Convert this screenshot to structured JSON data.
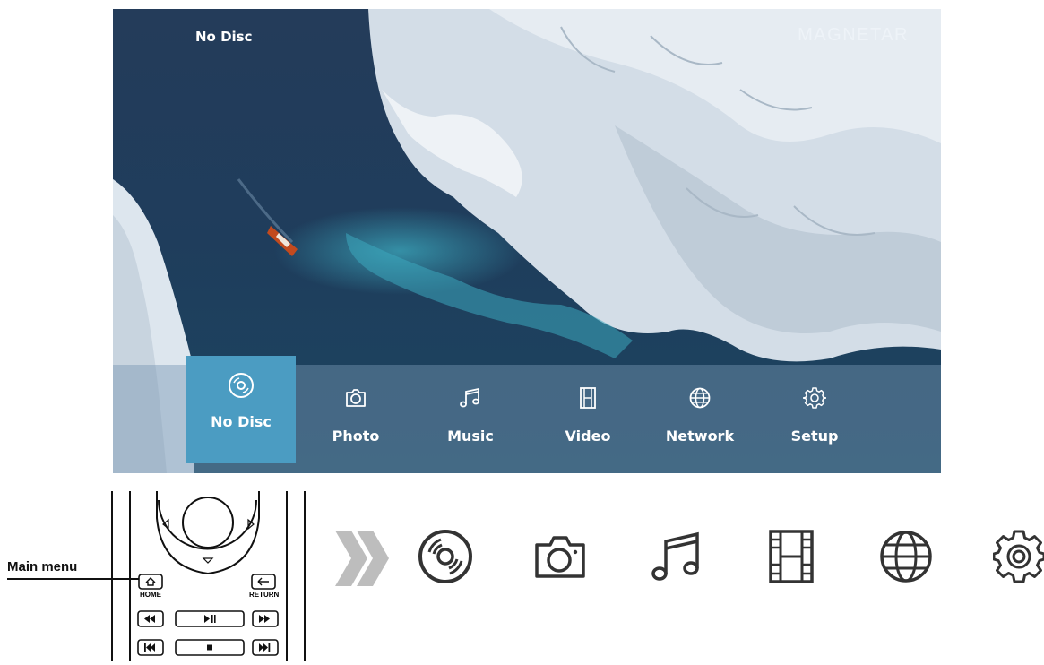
{
  "screen": {
    "title": "No Disc",
    "brand": "MAGNETAR"
  },
  "menu": {
    "items": [
      {
        "label": "No Disc",
        "icon": "disc-icon",
        "selected": true
      },
      {
        "label": "Photo",
        "icon": "camera-icon"
      },
      {
        "label": "Music",
        "icon": "music-note-icon"
      },
      {
        "label": "Video",
        "icon": "film-icon"
      },
      {
        "label": "Network",
        "icon": "globe-icon"
      },
      {
        "label": "Setup",
        "icon": "gear-icon"
      }
    ]
  },
  "remote": {
    "callout": "Main menu",
    "home_label": "HOME",
    "return_label": "RETURN"
  },
  "icon_strip": {
    "icons": [
      "disc-icon",
      "camera-icon",
      "music-note-icon",
      "film-icon",
      "globe-icon",
      "gear-icon"
    ]
  },
  "colors": {
    "selected": "#4b9cc2",
    "menu_bar": "rgba(120,150,180,0.45)",
    "ocean": "#1f3d5c",
    "ice": "#dfe7ef"
  }
}
